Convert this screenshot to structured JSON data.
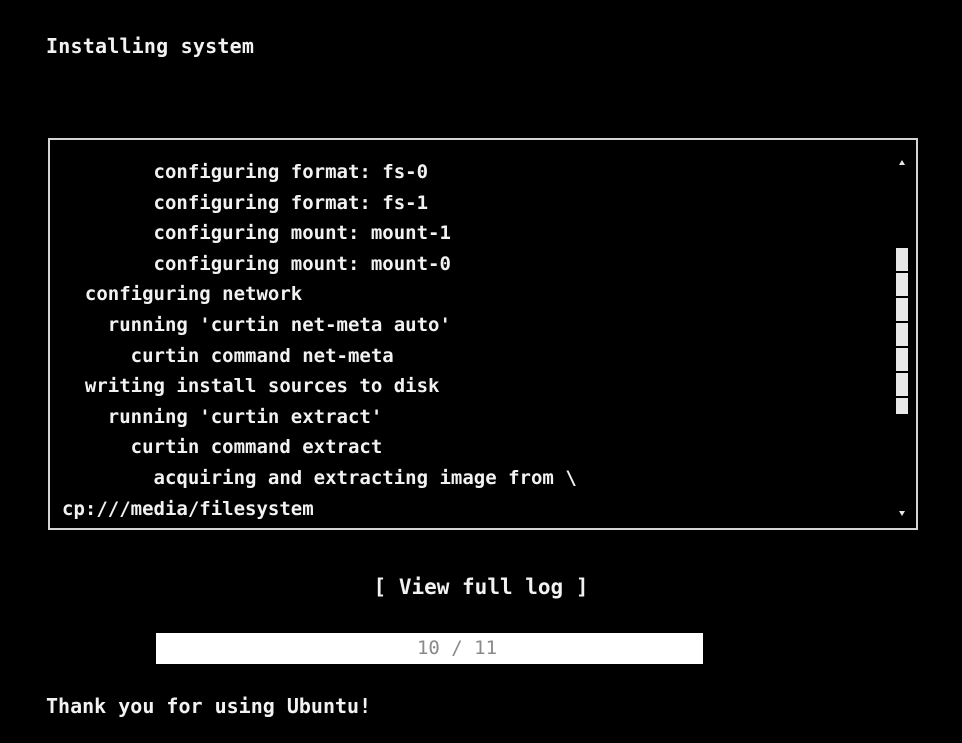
{
  "header": {
    "title": "Installing system"
  },
  "log": {
    "lines": [
      "        configuring format: fs-0",
      "        configuring format: fs-1",
      "        configuring mount: mount-1",
      "        configuring mount: mount-0",
      "  configuring network",
      "    running 'curtin net-meta auto'",
      "      curtin command net-meta",
      "  writing install sources to disk",
      "    running 'curtin extract'",
      "      curtin command extract",
      "        acquiring and extracting image from \\",
      "cp:///media/filesystem"
    ],
    "scroll_position": 0.47,
    "scroll_extent": 0.5
  },
  "actions": {
    "view_log_label": "[ View full log ]"
  },
  "progress": {
    "current": 10,
    "total": 11,
    "label": "10 / 11"
  },
  "footer": {
    "message": "Thank you for using Ubuntu!"
  },
  "colors": {
    "background": "#000000",
    "text": "#f2f2f2",
    "border": "#d4d4d4",
    "progress_fill": "#ffffff",
    "progress_text": "#8a8a8a"
  }
}
